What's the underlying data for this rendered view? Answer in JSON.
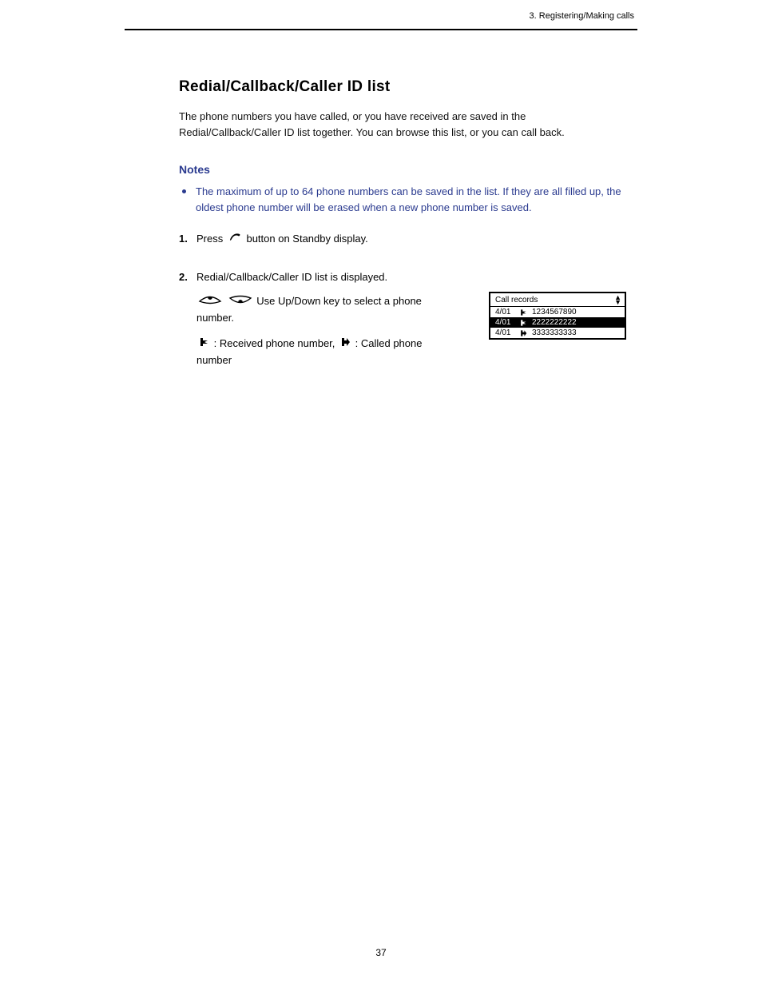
{
  "header": {
    "right_text": "3. Registering/Making calls"
  },
  "section": {
    "title": "Redial/Callback/Caller ID list",
    "intro": "The phone numbers you have called, or you have received are saved in the Redial/Callback/Caller ID list together. You can browse this list, or you can call back."
  },
  "notes": {
    "heading": "Notes",
    "bullet": "The maximum of up to 64 phone numbers can be saved in the list. If they are all filled up, the oldest phone number will be erased when a new phone number is saved."
  },
  "steps": [
    {
      "n": "1.",
      "pre": "Press ",
      "post": " button on Standby display.",
      "icon": "hook-off-icon"
    },
    {
      "n": "2.",
      "lines": [
        {
          "t": "Redial/Callback/Caller ID list is displayed."
        },
        {
          "t": "Use Up/Down key to select a phone number.",
          "leadIcons": [
            "eye-up-icon",
            "eye-down-icon"
          ]
        },
        {
          "frags": [
            {
              "icon": "in-arrow-icon"
            },
            {
              "t": " : Received phone number, "
            },
            {
              "icon": "out-arrow-icon"
            },
            {
              "t": " : Called phone number"
            }
          ]
        }
      ]
    }
  ],
  "screen": {
    "title": "Call records",
    "rows": [
      {
        "date": "4/01",
        "dir": "in",
        "num": "1234567890",
        "sel": false
      },
      {
        "date": "4/01",
        "dir": "in",
        "num": "2222222222",
        "sel": true
      },
      {
        "date": "4/01",
        "dir": "out",
        "num": "3333333333",
        "sel": false
      }
    ]
  },
  "footer": {
    "page": "37"
  }
}
